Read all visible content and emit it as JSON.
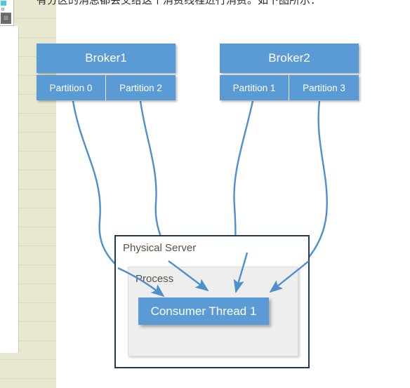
{
  "article": {
    "paragraph": "有分区的消息都会交给这个消费线程进行消费。如下图所示："
  },
  "colors": {
    "shape_blue": "#5B9BD5",
    "server_border_navy": "#1F3864",
    "process_gray": "#EEEEEE",
    "arrow_blue": "#4E90CD",
    "label_brown": "#595144",
    "page_margin_beige": "#E7E8CF"
  },
  "diagram": {
    "brokers": [
      {
        "name": "Broker1",
        "partitions": [
          {
            "label": "Partition 0"
          },
          {
            "label": "Partition 2"
          }
        ]
      },
      {
        "name": "Broker2",
        "partitions": [
          {
            "label": "Partition 1"
          },
          {
            "label": "Partition 3"
          }
        ]
      }
    ],
    "physical_server": {
      "label": "Physical Server",
      "process": {
        "label": "Process",
        "threads": [
          {
            "label": "Consumer Thread 1"
          }
        ]
      }
    },
    "connections": [
      {
        "from": "Partition 0",
        "to": "Consumer Thread 1"
      },
      {
        "from": "Partition 2",
        "to": "Consumer Thread 1"
      },
      {
        "from": "Partition 1",
        "to": "Consumer Thread 1"
      },
      {
        "from": "Partition 3",
        "to": "Consumer Thread 1"
      }
    ]
  }
}
